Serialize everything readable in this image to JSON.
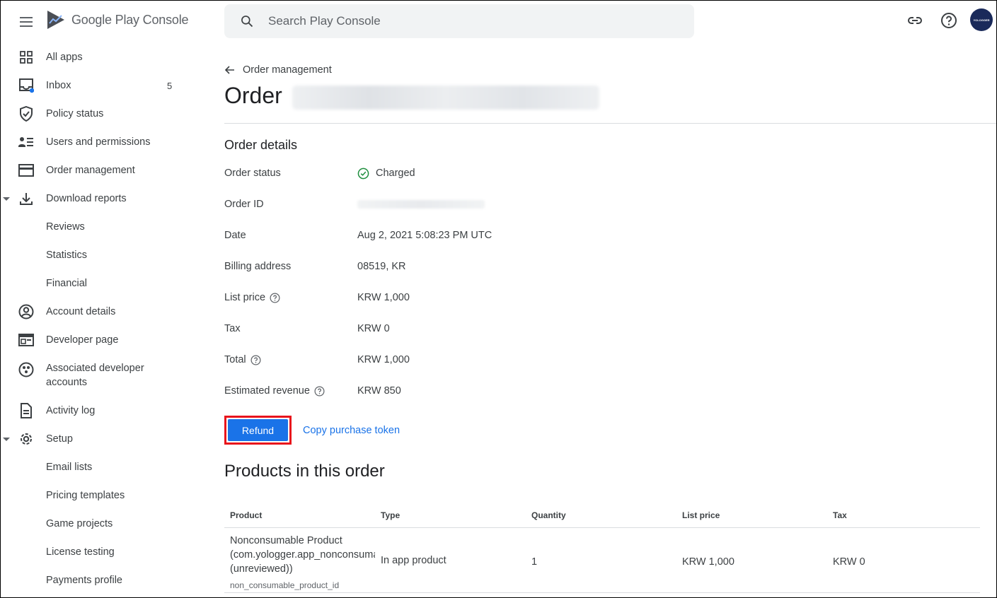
{
  "header": {
    "app_name": "Google Play Console",
    "search_placeholder": "Search Play Console",
    "avatar_label": "YOLOGGER"
  },
  "sidebar": {
    "items": [
      {
        "label": "All apps",
        "icon": "apps-grid-icon"
      },
      {
        "label": "Inbox",
        "icon": "inbox-icon",
        "badge": "5"
      },
      {
        "label": "Policy status",
        "icon": "shield-icon"
      },
      {
        "label": "Users and permissions",
        "icon": "users-icon"
      },
      {
        "label": "Order management",
        "icon": "credit-card-icon"
      },
      {
        "label": "Download reports",
        "icon": "download-icon"
      },
      {
        "label": "Reviews"
      },
      {
        "label": "Statistics"
      },
      {
        "label": "Financial"
      },
      {
        "label": "Account details",
        "icon": "account-circle-icon"
      },
      {
        "label": "Developer page",
        "icon": "web-page-icon"
      },
      {
        "label": "Associated developer accounts",
        "icon": "linked-accounts-icon"
      },
      {
        "label": "Activity log",
        "icon": "document-icon"
      },
      {
        "label": "Setup",
        "icon": "gear-icon"
      },
      {
        "label": "Email lists"
      },
      {
        "label": "Pricing templates"
      },
      {
        "label": "Game projects"
      },
      {
        "label": "License testing"
      },
      {
        "label": "Payments profile"
      }
    ]
  },
  "main": {
    "breadcrumb": "Order management",
    "title": "Order",
    "section_title": "Order details",
    "details": [
      {
        "label": "Order status",
        "value": "Charged"
      },
      {
        "label": "Order ID",
        "value": ""
      },
      {
        "label": "Date",
        "value": "Aug 2, 2021 5:08:23 PM UTC"
      },
      {
        "label": "Billing address",
        "value": "08519, KR"
      },
      {
        "label": "List price",
        "value": "KRW 1,000"
      },
      {
        "label": "Tax",
        "value": "KRW 0"
      },
      {
        "label": "Total",
        "value": "KRW 1,000"
      },
      {
        "label": "Estimated revenue",
        "value": "KRW 850"
      }
    ],
    "refund_label": "Refund",
    "copy_token_label": "Copy purchase token",
    "products_title": "Products in this order",
    "table": {
      "headers": [
        "Product",
        "Type",
        "Quantity",
        "List price",
        "Tax"
      ],
      "rows": [
        {
          "product_line1": "Nonconsumable Product",
          "product_line2": "(com.yologger.app_nonconsumable)",
          "product_line3": "(unreviewed))",
          "product_id": "non_consumable_product_id",
          "type": "In app product",
          "quantity": "1",
          "list_price": "KRW 1,000",
          "tax": "KRW 0"
        }
      ]
    }
  },
  "colors": {
    "accent": "#1a73e8",
    "highlight_border": "#e8141c",
    "success": "#1e8e3e"
  }
}
